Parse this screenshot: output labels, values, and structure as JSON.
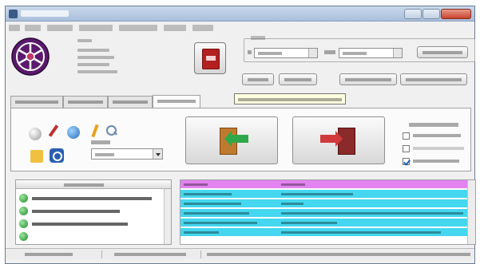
{
  "window": {
    "title": "",
    "version": "",
    "menu": [
      "",
      "",
      "",
      "",
      "",
      "",
      ""
    ]
  },
  "info": {
    "heading": "",
    "lines": [
      "",
      "",
      "",
      ""
    ]
  },
  "period": {
    "title": "",
    "from": "",
    "to_label": "",
    "to": "",
    "apply_label": "",
    "buttons": [
      "",
      "",
      "",
      ""
    ]
  },
  "tabs": [
    "",
    "",
    "",
    ""
  ],
  "active_tab": 3,
  "tooltip": "",
  "mode": {
    "label": "",
    "value": ""
  },
  "autostart": {
    "title": "",
    "options": [
      {
        "label": "",
        "checked": false
      },
      {
        "label": "",
        "checked": false
      },
      {
        "label": "",
        "checked": true
      }
    ]
  },
  "terminals": {
    "header": "",
    "items": [
      "",
      "",
      ""
    ]
  },
  "grid": {
    "headers": [
      "",
      ""
    ],
    "rows": [
      [
        "",
        ""
      ],
      [
        "",
        ""
      ],
      [
        "",
        ""
      ],
      [
        "",
        ""
      ],
      [
        "",
        ""
      ]
    ]
  },
  "status": [
    "",
    "",
    ""
  ],
  "colors": {
    "grid_header": "#e383f0",
    "grid_row": "#44d7ef",
    "online_indicator": "#1c8a2a",
    "version_text": "#1a4fb0"
  }
}
